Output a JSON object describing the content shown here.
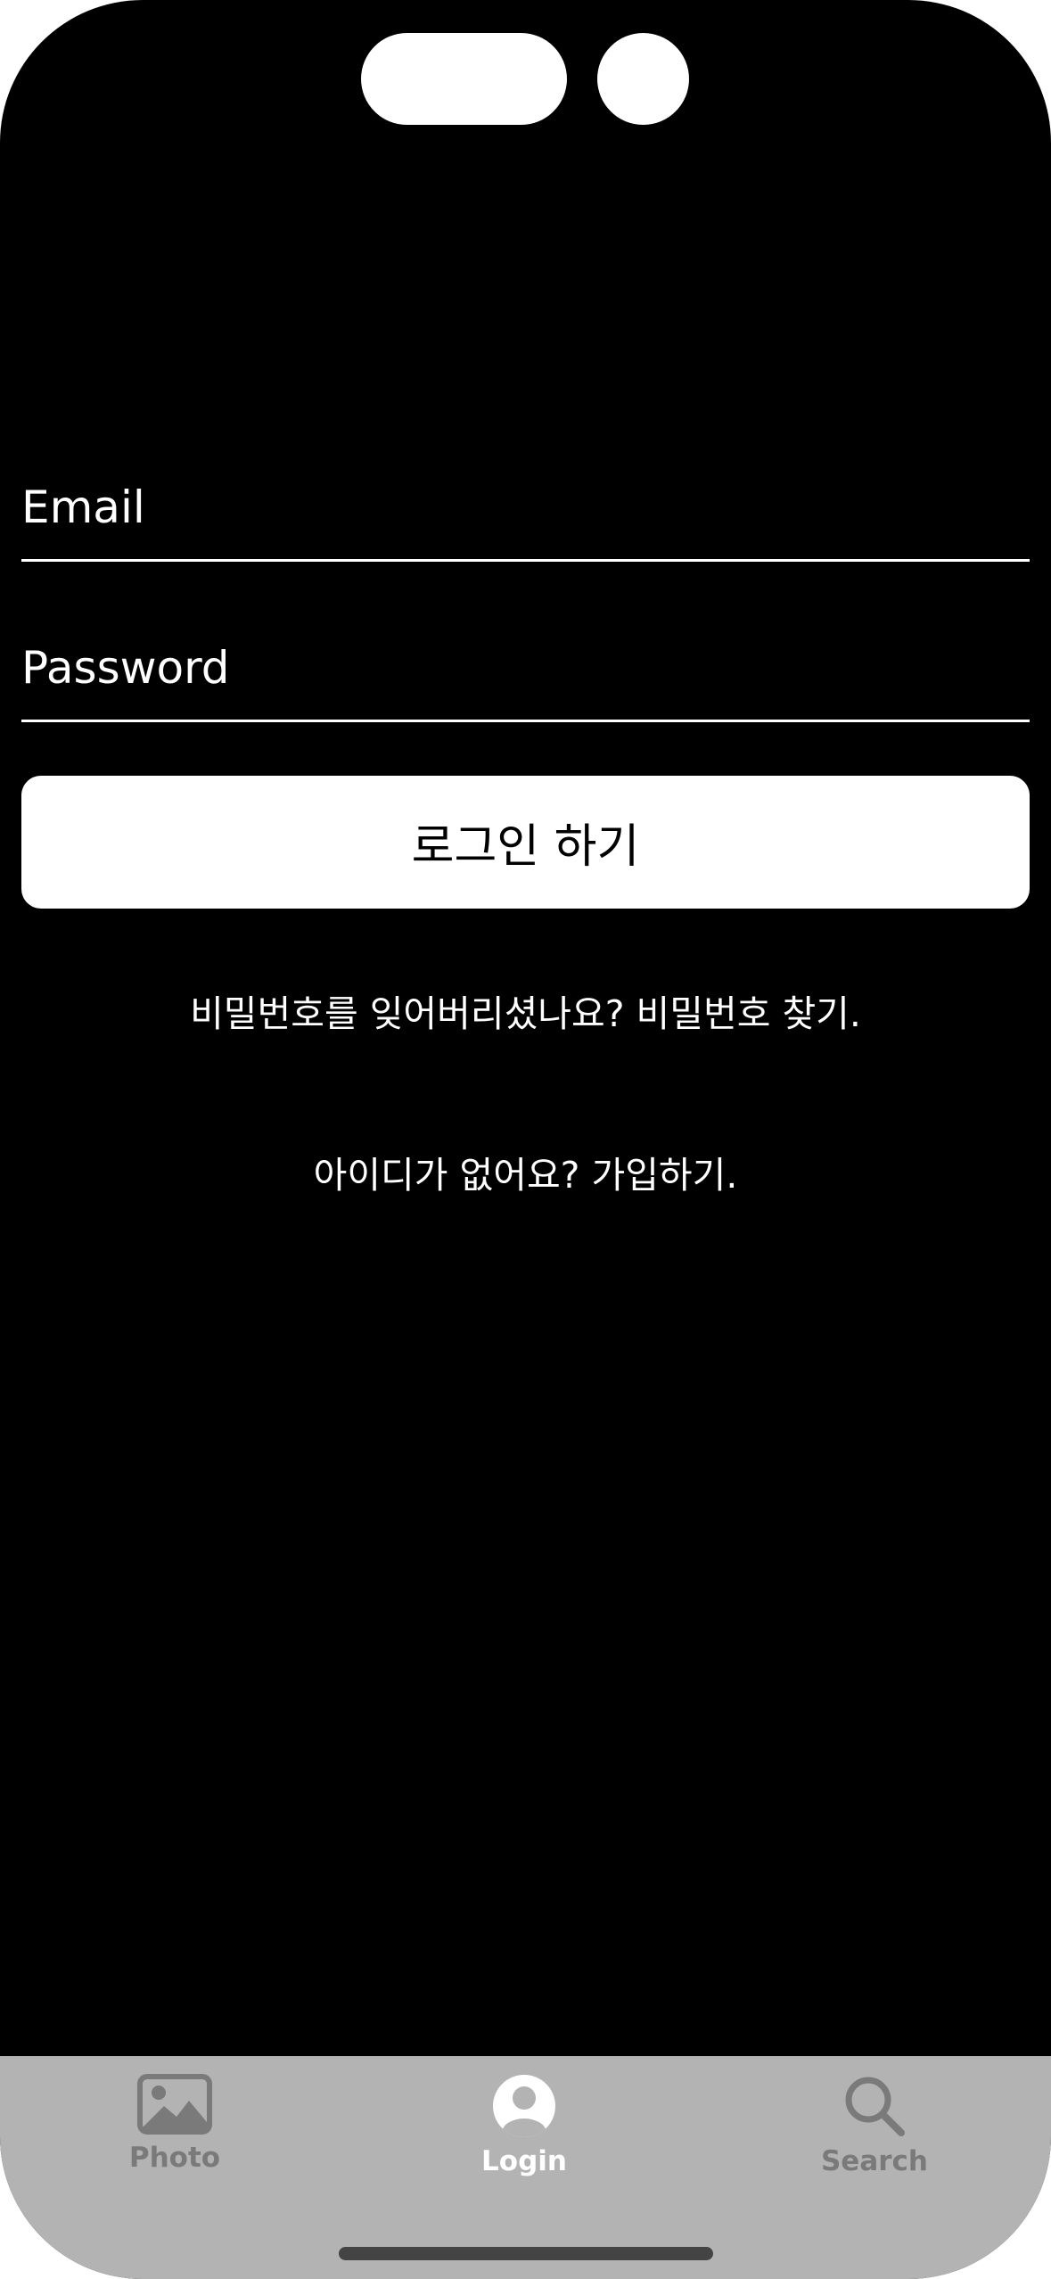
{
  "form": {
    "email_placeholder": "Email",
    "password_placeholder": "Password",
    "login_label": "로그인 하기",
    "forgot_text": "비밀번호를 잊어버리셨나요? 비밀번호 찾기.",
    "signup_text": "아이디가 없어요? 가입하기."
  },
  "tabbar": {
    "tabs": [
      {
        "label": "Photo",
        "icon": "photo-icon",
        "selected": false
      },
      {
        "label": "Login",
        "icon": "person-circle-icon",
        "selected": true
      },
      {
        "label": "Search",
        "icon": "magnifier-icon",
        "selected": false
      }
    ]
  },
  "colors": {
    "background": "#000000",
    "text": "#ffffff",
    "tabbar_background": "#b3b3b3",
    "tab_inactive": "#7a7a7a",
    "tab_active": "#ffffff"
  }
}
